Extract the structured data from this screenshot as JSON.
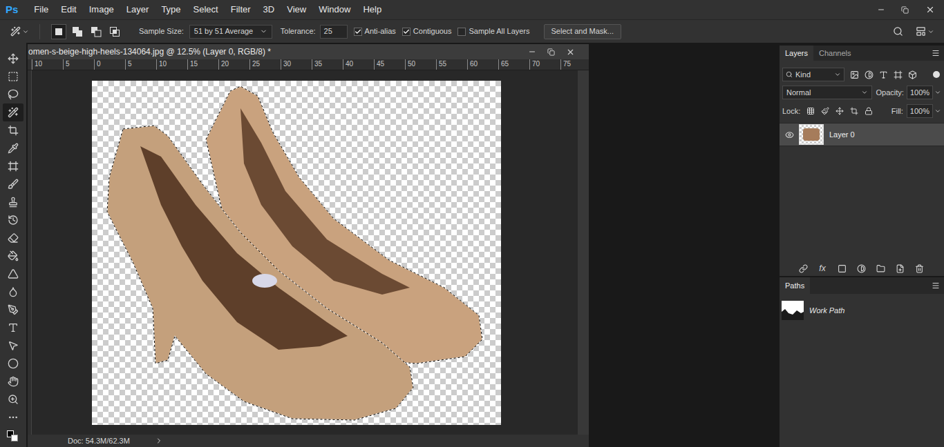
{
  "app": {
    "logo": "Ps"
  },
  "menu": [
    "File",
    "Edit",
    "Image",
    "Layer",
    "Type",
    "Select",
    "Filter",
    "3D",
    "View",
    "Window",
    "Help"
  ],
  "options_bar": {
    "selection_modes": [
      {
        "kind": "new",
        "selected": true
      },
      {
        "kind": "add",
        "selected": false
      },
      {
        "kind": "subtract",
        "selected": false
      },
      {
        "kind": "intersect",
        "selected": false
      }
    ],
    "sample_size_label": "Sample Size:",
    "sample_size": "51 by 51 Average",
    "tolerance_label": "Tolerance:",
    "tolerance": "25",
    "checkboxes": [
      {
        "label": "Anti-alias",
        "checked": true
      },
      {
        "label": "Contiguous",
        "checked": true
      },
      {
        "label": "Sample All Layers",
        "checked": false
      }
    ],
    "button": "Select and Mask..."
  },
  "tools": [
    {
      "kind": "move",
      "selected": false
    },
    {
      "kind": "marquee",
      "selected": false
    },
    {
      "kind": "lasso",
      "selected": false
    },
    {
      "kind": "wand",
      "selected": true
    },
    {
      "kind": "crop",
      "selected": false
    },
    {
      "kind": "eyedropper",
      "selected": false
    },
    {
      "kind": "frame",
      "selected": false
    },
    {
      "kind": "brush",
      "selected": false
    },
    {
      "kind": "stamp",
      "selected": false
    },
    {
      "kind": "history",
      "selected": false
    },
    {
      "kind": "eraser",
      "selected": false
    },
    {
      "kind": "bucket",
      "selected": false
    },
    {
      "kind": "blur",
      "selected": false
    },
    {
      "kind": "dodge",
      "selected": false
    },
    {
      "kind": "pen",
      "selected": false
    },
    {
      "kind": "type",
      "selected": false
    },
    {
      "kind": "path-select",
      "selected": false
    },
    {
      "kind": "ellipse",
      "selected": false
    },
    {
      "kind": "hand",
      "selected": false
    },
    {
      "kind": "zoom",
      "selected": false
    },
    {
      "kind": "more",
      "selected": false
    }
  ],
  "document": {
    "title": "omen-s-beige-high-heels-134064.jpg @ 12.5% (Layer 0, RGB/8) *",
    "ruler": [
      "10",
      "5",
      "0",
      "5",
      "10",
      "15",
      "20",
      "25",
      "30",
      "35",
      "40",
      "45",
      "50",
      "55",
      "60",
      "65",
      "70",
      "75"
    ],
    "status": "Doc: 54.3M/62.3M"
  },
  "layers_panel": {
    "tabs": [
      {
        "label": "Layers",
        "selected": true
      },
      {
        "label": "Channels",
        "selected": false
      }
    ],
    "filter": "Kind",
    "blend_mode": "Normal",
    "opacity_label": "Opacity:",
    "opacity": "100%",
    "lock_label": "Lock:",
    "fill_label": "Fill:",
    "fill": "100%",
    "layers": [
      {
        "name": "Layer 0",
        "visible": true,
        "selected": true
      }
    ],
    "footer": [
      {
        "kind": "link",
        "label": ""
      },
      {
        "kind": "fx",
        "label": "fx"
      },
      {
        "kind": "mask",
        "label": ""
      },
      {
        "kind": "adjustment",
        "label": ""
      },
      {
        "kind": "group",
        "label": ""
      },
      {
        "kind": "new",
        "label": ""
      },
      {
        "kind": "delete",
        "label": ""
      }
    ]
  },
  "paths_panel": {
    "tabs": [
      {
        "label": "Paths",
        "selected": true
      }
    ],
    "paths": [
      {
        "name": "Work Path",
        "selected": false
      }
    ]
  }
}
